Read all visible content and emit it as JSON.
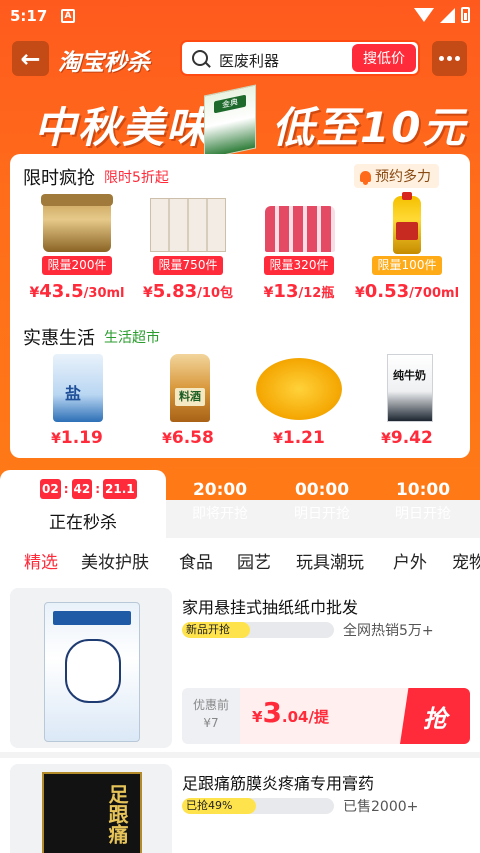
{
  "status_bar": {
    "time": "5:17",
    "notif": "A"
  },
  "nav": {
    "logo": "淘宝秒杀",
    "search_text": "医废利器",
    "search_button": "搜低价",
    "back_icon": "arrow-left-icon",
    "more_icon": "more-dots-icon"
  },
  "banner": {
    "left_text": "中秋美味",
    "right_text": "低至10元",
    "product_label": "金典"
  },
  "flash_sale": {
    "title": "限时疯抢",
    "subtitle": "限时5折起",
    "remind": "预约多力",
    "products": [
      {
        "limit": "限量200件",
        "currency": "¥",
        "price": "43.5",
        "unit": "/30ml"
      },
      {
        "limit": "限量750件",
        "currency": "¥",
        "price": "5.83",
        "unit": "/10包"
      },
      {
        "limit": "限量320件",
        "currency": "¥",
        "price": "13",
        "unit": "/12瓶"
      },
      {
        "limit": "限量100件",
        "currency": "¥",
        "price": "0.53",
        "unit": "/700ml"
      }
    ]
  },
  "daily_life": {
    "title": "实惠生活",
    "subtitle": "生活超市",
    "products": [
      {
        "label": "盐",
        "currency": "¥",
        "price": "1.19"
      },
      {
        "label": "料酒",
        "currency": "¥",
        "price": "6.58"
      },
      {
        "label": "",
        "currency": "¥",
        "price": "1.21"
      },
      {
        "label": "纯牛奶",
        "currency": "¥",
        "price": "9.42"
      }
    ]
  },
  "sessions": {
    "countdown": {
      "h": "02",
      "m": "42",
      "s": "21.1"
    },
    "active_label": "正在秒杀",
    "upcoming": [
      {
        "time": "20:00",
        "status": "即将开抢"
      },
      {
        "time": "00:00",
        "status": "明日开抢"
      },
      {
        "time": "10:00",
        "status": "明日开抢"
      }
    ]
  },
  "categories": [
    "精选",
    "美妆护肤",
    "食品",
    "园艺",
    "玩具潮玩",
    "户外",
    "宠物"
  ],
  "items": [
    {
      "title": "家用悬挂式抽纸纸巾批发",
      "progress_text": "新品开抢",
      "progress": 0.45,
      "sold": "全网热销5万+",
      "orig_label": "优惠前",
      "orig_price": "¥7",
      "currency": "¥",
      "price": "3",
      "price_decimal": ".04",
      "unit": "/提",
      "button": "抢"
    },
    {
      "title": "足跟痛筋膜炎疼痛专用膏药",
      "progress_text": "已抢49%",
      "progress": 0.49,
      "sold": "已售2000+",
      "box_label": "足跟痛"
    }
  ],
  "colors": {
    "brand_orange": "#ff6d1a",
    "accent_red": "#ff2a3a",
    "highlight_yellow": "#ffe34d"
  }
}
